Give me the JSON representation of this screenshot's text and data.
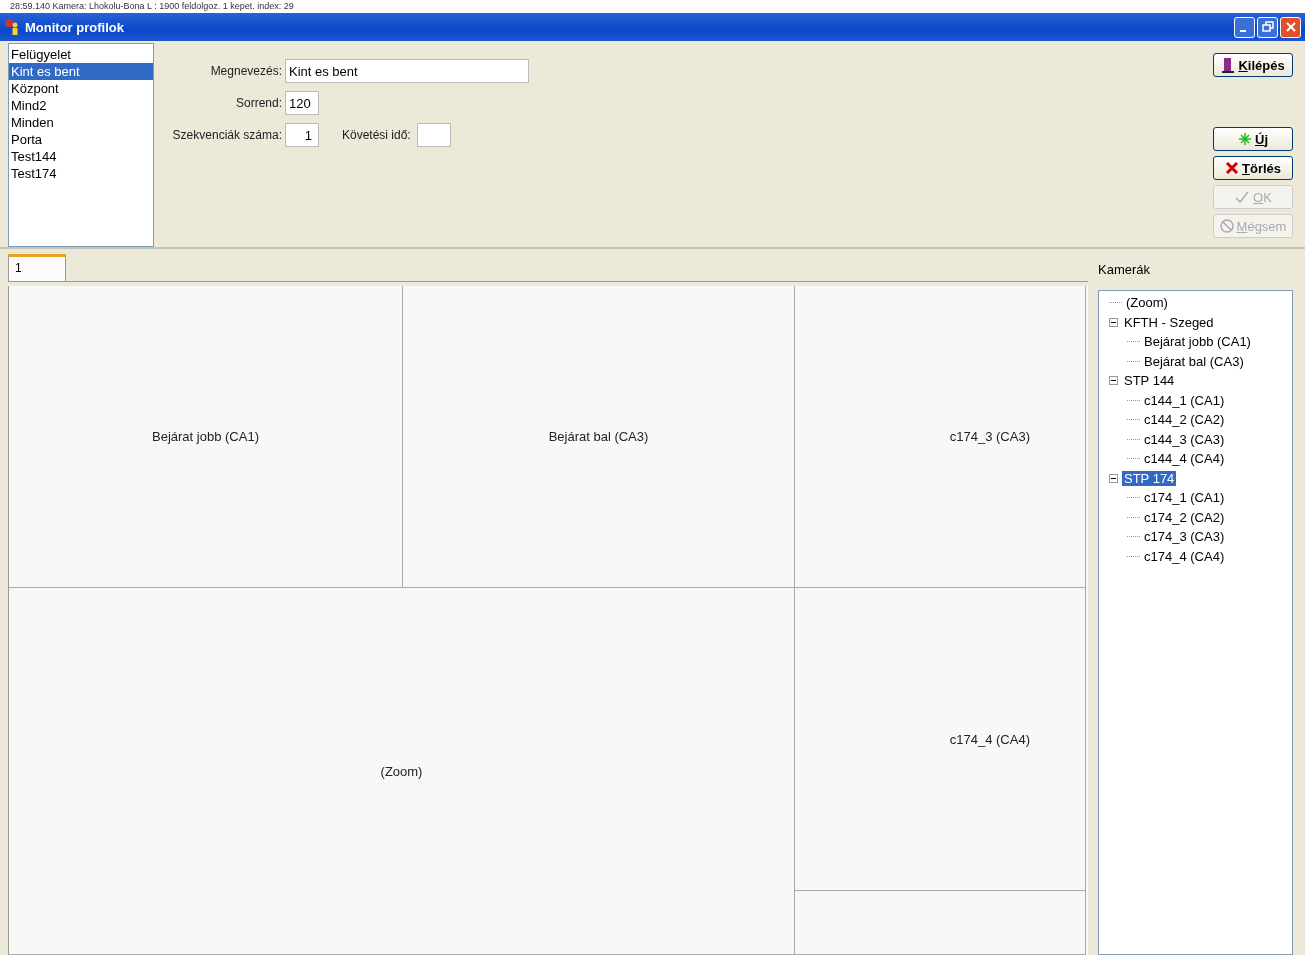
{
  "background_log": "28:59.140 Kamera: Lhokolu-Bona L : 1900 feldolgoz. 1 kepet. index: 29",
  "window": {
    "title": "Monitor profilok"
  },
  "profiles": [
    {
      "label": "Felügyelet",
      "selected": false
    },
    {
      "label": "Kint es bent",
      "selected": true
    },
    {
      "label": "Központ",
      "selected": false
    },
    {
      "label": "Mind2",
      "selected": false
    },
    {
      "label": "Minden",
      "selected": false
    },
    {
      "label": "Porta",
      "selected": false
    },
    {
      "label": "Test144",
      "selected": false
    },
    {
      "label": "Test174",
      "selected": false
    }
  ],
  "form": {
    "name_label": "Megnevezés:",
    "name_value": "Kint es bent",
    "order_label": "Sorrend:",
    "order_value": "120",
    "seq_label": "Szekvenciák száma:",
    "seq_value": "1",
    "follow_label": "Követési idő:"
  },
  "buttons": [
    {
      "kind": "exit",
      "label": "Kilépés",
      "disabled": false
    },
    {
      "kind": "new",
      "label": "Új",
      "disabled": false
    },
    {
      "kind": "delete",
      "label": "Törlés",
      "disabled": false
    },
    {
      "kind": "ok",
      "label": "OK",
      "disabled": true
    },
    {
      "kind": "cancel",
      "label": "Mégsem",
      "disabled": true
    }
  ],
  "tabs": [
    {
      "label": "1",
      "selected": true
    }
  ],
  "grid_cells": [
    {
      "label": "Bejárat jobb (CA1)"
    },
    {
      "label": "Bejárat bal (CA3)"
    },
    {
      "label": "c174_3 (CA3)"
    },
    {
      "label": "(Zoom)"
    },
    {
      "label": "c174_4 (CA4)"
    },
    {}
  ],
  "cameras": {
    "title": "Kamerák",
    "tree": [
      {
        "label": "(Zoom)",
        "selected": false
      },
      {
        "label": "KFTH - Szeged",
        "selected": false,
        "expanded": true,
        "children": [
          {
            "label": "Bejárat jobb (CA1)",
            "selected": false
          },
          {
            "label": "Bejárat bal (CA3)",
            "selected": false
          }
        ]
      },
      {
        "label": "STP 144",
        "selected": false,
        "expanded": true,
        "children": [
          {
            "label": "c144_1 (CA1)",
            "selected": false
          },
          {
            "label": "c144_2 (CA2)",
            "selected": false
          },
          {
            "label": "c144_3 (CA3)",
            "selected": false
          },
          {
            "label": "c144_4 (CA4)",
            "selected": false
          }
        ]
      },
      {
        "label": "STP 174",
        "selected": true,
        "expanded": true,
        "children": [
          {
            "label": "c174_1 (CA1)",
            "selected": false
          },
          {
            "label": "c174_2 (CA2)",
            "selected": false
          },
          {
            "label": "c174_3 (CA3)",
            "selected": false
          },
          {
            "label": "c174_4 (CA4)",
            "selected": false
          }
        ]
      }
    ]
  }
}
